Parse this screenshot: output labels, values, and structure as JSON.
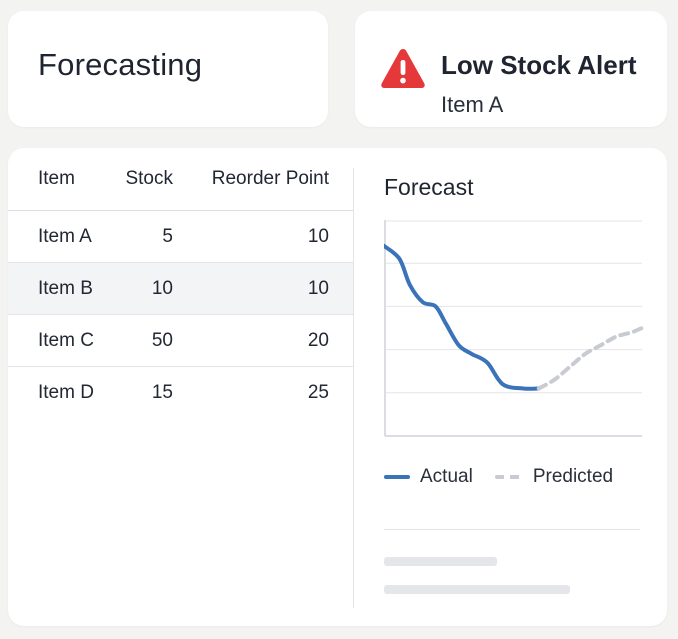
{
  "header": {
    "title": "Forecasting"
  },
  "alert": {
    "title": "Low Stock Alert",
    "item": "Item A",
    "icon": "warning-triangle-icon",
    "icon_color": "#e5383b"
  },
  "table": {
    "columns": [
      "Item",
      "Stock",
      "Reorder Point"
    ],
    "rows": [
      {
        "item": "Item A",
        "stock": "5",
        "reorder": "10"
      },
      {
        "item": "Item B",
        "stock": "10",
        "reorder": "10"
      },
      {
        "item": "Item C",
        "stock": "50",
        "reorder": "20"
      },
      {
        "item": "Item D",
        "stock": "15",
        "reorder": "25"
      }
    ],
    "highlighted_row_index": 1
  },
  "forecast": {
    "title": "Forecast",
    "legend": {
      "actual": "Actual",
      "predicted": "Predicted"
    },
    "colors": {
      "actual": "#3b73b9",
      "predicted": "#c8cbd2",
      "grid": "#e4e5e8"
    }
  },
  "chart_data": {
    "type": "line",
    "title": "Forecast",
    "xlabel": "",
    "ylabel": "",
    "grid": true,
    "legend_position": "bottom",
    "ylim": [
      0,
      5
    ],
    "xlim": [
      0,
      10
    ],
    "series": [
      {
        "name": "Actual",
        "x": [
          0,
          0.6,
          1.0,
          1.5,
          2.0,
          2.4,
          2.9,
          3.4,
          4.0,
          4.6,
          5.4,
          6.0
        ],
        "y": [
          4.4,
          4.1,
          3.5,
          3.1,
          3.0,
          2.6,
          2.1,
          1.9,
          1.7,
          1.2,
          1.1,
          1.1
        ]
      },
      {
        "name": "Predicted",
        "x": [
          6.0,
          6.6,
          7.2,
          7.8,
          8.4,
          9.0,
          9.6,
          10.0
        ],
        "y": [
          1.1,
          1.3,
          1.6,
          1.9,
          2.1,
          2.3,
          2.4,
          2.5
        ]
      }
    ]
  }
}
